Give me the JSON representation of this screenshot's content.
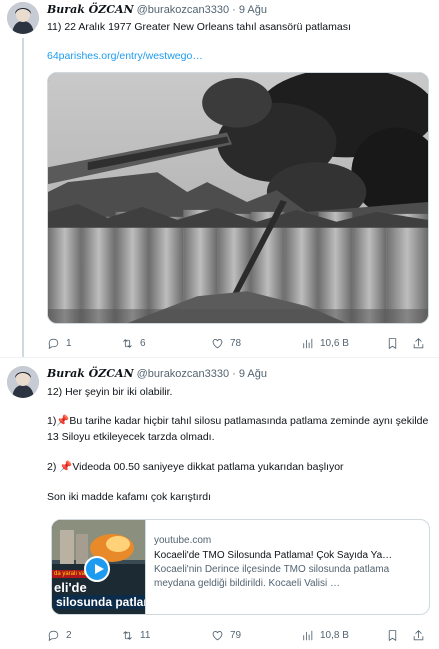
{
  "tweets": [
    {
      "author": {
        "name": "Burak ÖZCAN",
        "handle": "@burakozcan3330",
        "time": "9 Ağu"
      },
      "text": "11) 22 Aralık 1977 Greater New Orleans tahıl asansörü patlaması",
      "link": "64parishes.org/entry/westwego…",
      "media": {
        "type": "photo",
        "description_icon": "photo-grain-elevator-explosion"
      },
      "actions": {
        "replies": "1",
        "retweets": "6",
        "likes": "78",
        "views": "10,6 B"
      }
    },
    {
      "author": {
        "name": "Burak ÖZCAN",
        "handle": "@burakozcan3330",
        "time": "9 Ağu"
      },
      "lines": [
        "12) Her şeyin bir iki olabilir.",
        "1)📌Bu tarihe kadar  hiçbir tahıl silosu patlamasında patlama zeminde aynı şekilde 13 Siloyu etkileyecek tarzda olmadı.",
        "2) 📌Videoda 00.50 saniyeye dikkat patlama yukarıdan başlıyor",
        "Son iki madde kafamı çok karıştırdı"
      ],
      "card": {
        "domain": "youtube.com",
        "title": "Kocaeli'de TMO Silosunda Patlama! Çok Sayıda Ya…",
        "description": "Kocaeli'nin Derince ilçesinde TMO silosunda patlama meydana geldiği bildirildi. Kocaeli Valisi …",
        "thumb_tag": "da yaralı var!",
        "thumb_line1": "eli'de",
        "thumb_line2": "silosunda patlam"
      },
      "actions": {
        "replies": "2",
        "retweets": "11",
        "likes": "79",
        "views": "10,8 B"
      }
    }
  ],
  "colors": {
    "link": "#1d9bf0",
    "secondary_text": "#536471",
    "border": "#cfd9de",
    "pin": "#e0245e"
  },
  "icons": [
    "reply-icon",
    "retweet-icon",
    "like-icon",
    "views-icon",
    "bookmark-icon",
    "share-icon",
    "play-icon",
    "pin-icon"
  ]
}
